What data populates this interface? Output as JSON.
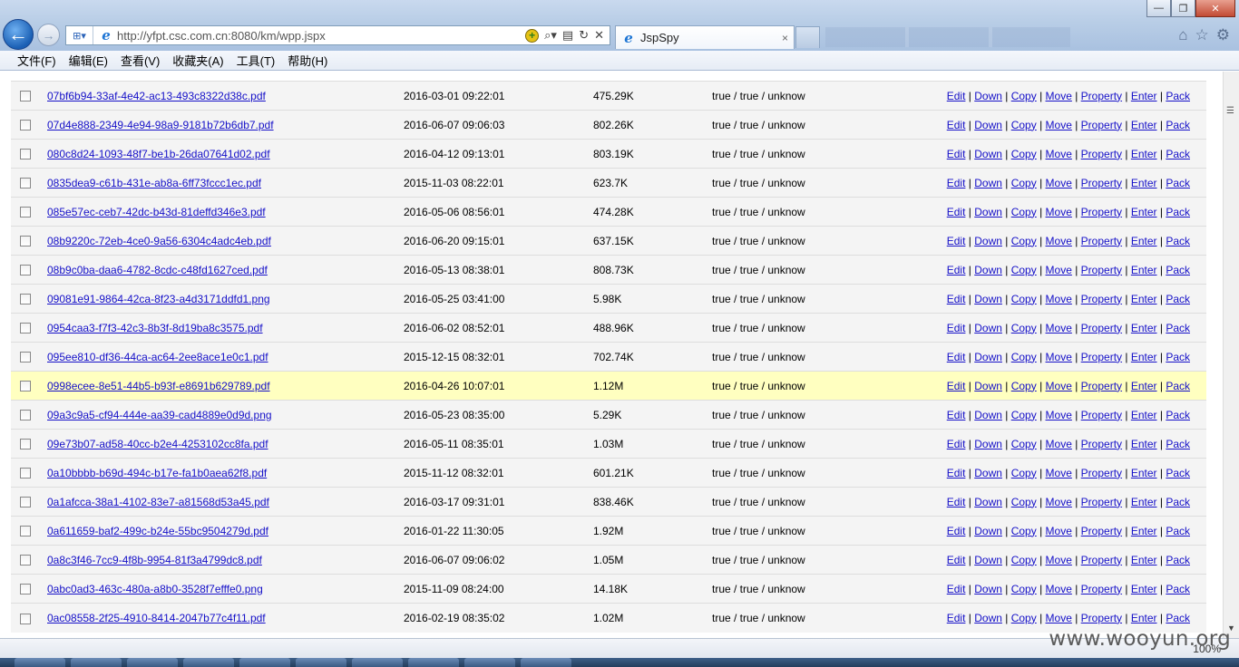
{
  "browser": {
    "url": "http://yfpt.csc.com.cn:8080/km/wpp.jspx",
    "tab_title": "JspSpy",
    "back_label": "←",
    "forward_label": "→",
    "tab_close": "×",
    "window_controls": {
      "minimize": "—",
      "maximize": "❐",
      "close": "✕"
    },
    "zoom": "100%"
  },
  "menu": [
    "文件(F)",
    "编辑(E)",
    "查看(V)",
    "收藏夹(A)",
    "工具(T)",
    "帮助(H)"
  ],
  "actions": [
    "Edit",
    "Down",
    "Copy",
    "Move",
    "Property",
    "Enter",
    "Pack"
  ],
  "highlight_color": "#ffffc0",
  "link_color": "#1510c8",
  "files": [
    {
      "name": "07bf6b94-33af-4e42-ac13-493c8322d38c.pdf",
      "modified": "2016-03-01 09:22:01",
      "size": "475.29K",
      "perm": "true / true / unknow"
    },
    {
      "name": "07d4e888-2349-4e94-98a9-9181b72b6db7.pdf",
      "modified": "2016-06-07 09:06:03",
      "size": "802.26K",
      "perm": "true / true / unknow"
    },
    {
      "name": "080c8d24-1093-48f7-be1b-26da07641d02.pdf",
      "modified": "2016-04-12 09:13:01",
      "size": "803.19K",
      "perm": "true / true / unknow"
    },
    {
      "name": "0835dea9-c61b-431e-ab8a-6ff73fccc1ec.pdf",
      "modified": "2015-11-03 08:22:01",
      "size": "623.7K",
      "perm": "true / true / unknow"
    },
    {
      "name": "085e57ec-ceb7-42dc-b43d-81deffd346e3.pdf",
      "modified": "2016-05-06 08:56:01",
      "size": "474.28K",
      "perm": "true / true / unknow"
    },
    {
      "name": "08b9220c-72eb-4ce0-9a56-6304c4adc4eb.pdf",
      "modified": "2016-06-20 09:15:01",
      "size": "637.15K",
      "perm": "true / true / unknow"
    },
    {
      "name": "08b9c0ba-daa6-4782-8cdc-c48fd1627ced.pdf",
      "modified": "2016-05-13 08:38:01",
      "size": "808.73K",
      "perm": "true / true / unknow"
    },
    {
      "name": "09081e91-9864-42ca-8f23-a4d3171ddfd1.png",
      "modified": "2016-05-25 03:41:00",
      "size": "5.98K",
      "perm": "true / true / unknow"
    },
    {
      "name": "0954caa3-f7f3-42c3-8b3f-8d19ba8c3575.pdf",
      "modified": "2016-06-02 08:52:01",
      "size": "488.96K",
      "perm": "true / true / unknow"
    },
    {
      "name": "095ee810-df36-44ca-ac64-2ee8ace1e0c1.pdf",
      "modified": "2015-12-15 08:32:01",
      "size": "702.74K",
      "perm": "true / true / unknow"
    },
    {
      "name": "0998ecee-8e51-44b5-b93f-e8691b629789.pdf",
      "modified": "2016-04-26 10:07:01",
      "size": "1.12M",
      "perm": "true / true / unknow",
      "highlighted": true
    },
    {
      "name": "09a3c9a5-cf94-444e-aa39-cad4889e0d9d.png",
      "modified": "2016-05-23 08:35:00",
      "size": "5.29K",
      "perm": "true / true / unknow"
    },
    {
      "name": "09e73b07-ad58-40cc-b2e4-4253102cc8fa.pdf",
      "modified": "2016-05-11 08:35:01",
      "size": "1.03M",
      "perm": "true / true / unknow"
    },
    {
      "name": "0a10bbbb-b69d-494c-b17e-fa1b0aea62f8.pdf",
      "modified": "2015-11-12 08:32:01",
      "size": "601.21K",
      "perm": "true / true / unknow"
    },
    {
      "name": "0a1afcca-38a1-4102-83e7-a81568d53a45.pdf",
      "modified": "2016-03-17 09:31:01",
      "size": "838.46K",
      "perm": "true / true / unknow"
    },
    {
      "name": "0a611659-baf2-499c-b24e-55bc9504279d.pdf",
      "modified": "2016-01-22 11:30:05",
      "size": "1.92M",
      "perm": "true / true / unknow"
    },
    {
      "name": "0a8c3f46-7cc9-4f8b-9954-81f3a4799dc8.pdf",
      "modified": "2016-06-07 09:06:02",
      "size": "1.05M",
      "perm": "true / true / unknow"
    },
    {
      "name": "0abc0ad3-463c-480a-a8b0-3528f7efffe0.png",
      "modified": "2015-11-09 08:24:00",
      "size": "14.18K",
      "perm": "true / true / unknow"
    },
    {
      "name": "0ac08558-2f25-4910-8414-2047b77c4f11.pdf",
      "modified": "2016-02-19 08:35:02",
      "size": "1.02M",
      "perm": "true / true / unknow"
    }
  ],
  "watermark": "www.wooyun.org"
}
